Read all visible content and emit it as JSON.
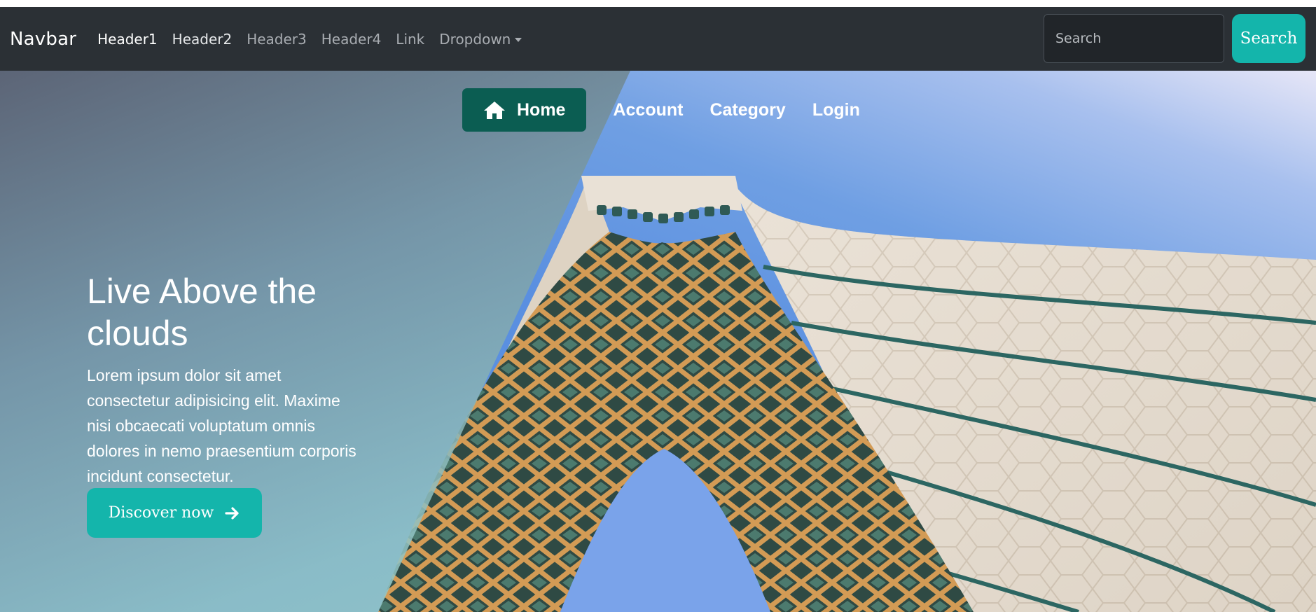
{
  "navbar": {
    "brand": "Navbar",
    "links": [
      {
        "label": "Header1"
      },
      {
        "label": "Header2"
      },
      {
        "label": "Header3"
      },
      {
        "label": "Header4"
      },
      {
        "label": "Link"
      },
      {
        "label": "Dropdown"
      }
    ],
    "search": {
      "placeholder": "Search",
      "button_label": "Search"
    },
    "colors": {
      "background": "#2b3035",
      "accent": "#14b5ab"
    }
  },
  "hero_nav": {
    "home_label": "Home",
    "account_label": "Account",
    "category_label": "Category",
    "login_label": "Login",
    "icons": {
      "home": "home-icon"
    },
    "colors": {
      "home_background": "#0b5d52"
    }
  },
  "hero": {
    "title": "Live Above the clouds",
    "body": "Lorem ipsum dolor sit amet consectetur adipisicing elit. Maxime nisi obcaecati voluptatum omnis dolores in nemo praesentium corporis incidunt consectetur.",
    "cta_label": "Discover now",
    "icons": {
      "cta": "arrow-right-icon"
    }
  }
}
